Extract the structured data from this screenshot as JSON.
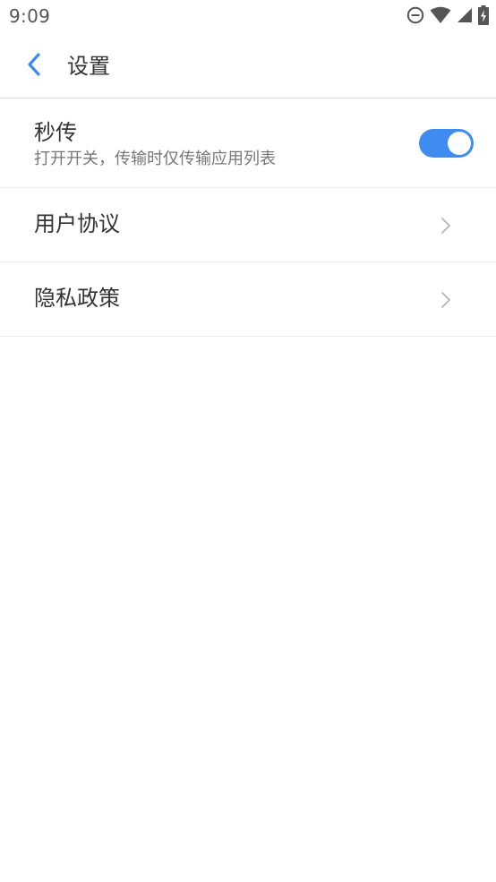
{
  "status_bar": {
    "time": "9:09",
    "icons": [
      "do-not-disturb-icon",
      "wifi-icon",
      "cell-signal-icon",
      "battery-charging-icon"
    ]
  },
  "header": {
    "back_icon": "chevron-left-icon",
    "title": "设置"
  },
  "settings": {
    "instant_transfer": {
      "title": "秒传",
      "subtitle": "打开开关，传输时仅传输应用列表",
      "enabled": true
    },
    "user_agreement": {
      "title": "用户协议",
      "icon": "chevron-right-icon"
    },
    "privacy_policy": {
      "title": "隐私政策",
      "icon": "chevron-right-icon"
    }
  },
  "colors": {
    "accent": "#3e8cf0",
    "text_primary": "#333333",
    "text_secondary": "#777777",
    "divider": "#ececec",
    "status_icon": "#555555"
  }
}
